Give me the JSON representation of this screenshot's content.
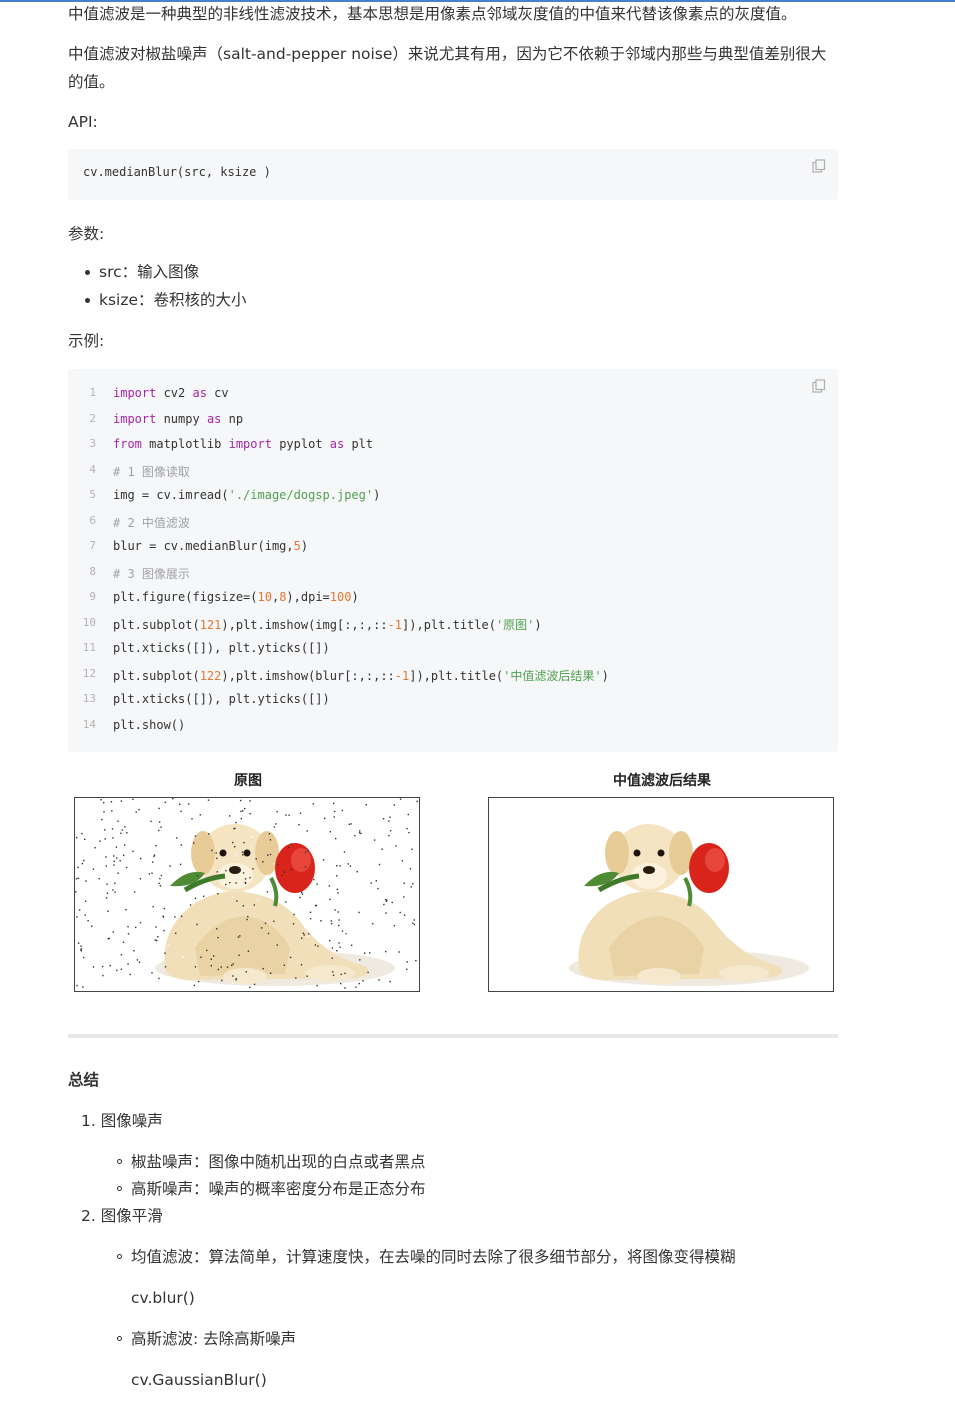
{
  "intro": {
    "p1": "中值滤波是一种典型的非线性滤波技术，基本思想是用像素点邻域灰度值的中值来代替该像素点的灰度值。",
    "p2": "中值滤波对椒盐噪声（salt-and-pepper noise）来说尤其有用，因为它不依赖于邻域内那些与典型值差别很大的值。",
    "api_label": "API:"
  },
  "api_code": "cv.medianBlur(src, ksize )",
  "params": {
    "label": "参数:",
    "items": [
      "src：输入图像",
      "ksize：卷积核的大小"
    ]
  },
  "example_label": "示例:",
  "code_lines": [
    {
      "n": "1",
      "t": "import cv2 as cv"
    },
    {
      "n": "2",
      "t": "import numpy as np"
    },
    {
      "n": "3",
      "t": "from matplotlib import pyplot as plt"
    },
    {
      "n": "4",
      "t": "# 1 图像读取"
    },
    {
      "n": "5",
      "t": "img = cv.imread('./image/dogsp.jpeg')"
    },
    {
      "n": "6",
      "t": "# 2 中值滤波"
    },
    {
      "n": "7",
      "t": "blur = cv.medianBlur(img,5)"
    },
    {
      "n": "8",
      "t": "# 3 图像展示"
    },
    {
      "n": "9",
      "t": "plt.figure(figsize=(10,8),dpi=100)"
    },
    {
      "n": "10",
      "t": "plt.subplot(121),plt.imshow(img[:,:,::-1]),plt.title('原图')"
    },
    {
      "n": "11",
      "t": "plt.xticks([]), plt.yticks([])"
    },
    {
      "n": "12",
      "t": "plt.subplot(122),plt.imshow(blur[:,:,::-1]),plt.title('中值滤波后结果')"
    },
    {
      "n": "13",
      "t": "plt.xticks([]), plt.yticks([])"
    },
    {
      "n": "14",
      "t": "plt.show()"
    }
  ],
  "figures": {
    "left_title": "原图",
    "right_title": "中值滤波后结果"
  },
  "summary": {
    "heading": "总结",
    "item1": "1. 图像噪声",
    "item1_sub": [
      "椒盐噪声：图像中随机出现的白点或者黑点",
      "高斯噪声：噪声的概率密度分布是正态分布"
    ],
    "item2": "2. 图像平滑",
    "item2_sub1": "均值滤波：算法简单，计算速度快，在去噪的同时去除了很多细节部分，将图像变得模糊",
    "item2_code1": "cv.blur()",
    "item2_sub2": "高斯滤波: 去除高斯噪声",
    "item2_code2": "cv.GaussianBlur()"
  },
  "colors": {
    "accent": "#4a7fd0",
    "code_bg": "#f6f7f9",
    "keyword": "#a626a4",
    "string": "#50a14f",
    "number": "#e6772e",
    "comment": "#a0a1a7"
  }
}
